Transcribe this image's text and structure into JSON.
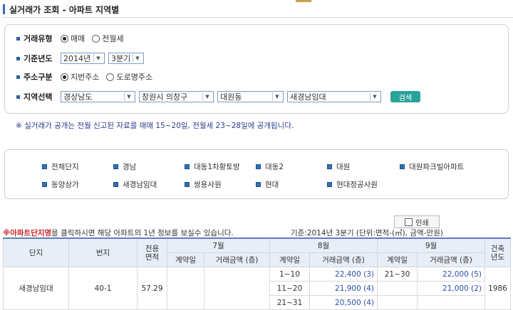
{
  "page_title": "실거래가 조회 - 아파트 지역별",
  "search": {
    "deal_type": {
      "label": "거래유형",
      "options": [
        {
          "text": "매매",
          "checked": true
        },
        {
          "text": "전월세",
          "checked": false
        }
      ]
    },
    "period": {
      "label": "기준년도",
      "year": "2014년",
      "quarter": "3분기"
    },
    "address": {
      "label": "주소구분",
      "options": [
        {
          "text": "지번주소",
          "checked": true
        },
        {
          "text": "도로명주소",
          "checked": false
        }
      ]
    },
    "region": {
      "label": "지역선택",
      "province": "경상남도",
      "city": "창원시 의창구",
      "dong": "대원동",
      "complex": "새경남임대"
    },
    "search_button": "검색"
  },
  "notice": "※ 실거래가 공개는 전월 신고된 자료를 매매 15~20일, 전월세 23~28일에 공개됩니다.",
  "complexes": [
    "전체단지",
    "경남",
    "대동1차황토방",
    "대동2",
    "대원",
    "대원파크빌아파트",
    "동양상가",
    "새경남임대",
    "쌍용사원",
    "현대",
    "현대정공사원"
  ],
  "hint": {
    "bold": "※아파트단지명",
    "rest": "을 클릭하시면 해당 아파트의 1년 정보를 보실수 있습니다."
  },
  "basis": "기준:2014년 3분기   (단위:면적-(㎡), 금액-만원)",
  "print_label": "인쇄",
  "table": {
    "headers": {
      "complex": "단지",
      "lot": "번지",
      "area": "전용\n면적",
      "build_year": "건축\n년도"
    },
    "months": [
      "7월",
      "8월",
      "9월"
    ],
    "sub": {
      "contract_day": "계약일",
      "amount": "거래금액 (층)"
    },
    "row": {
      "complex": "새경남임대",
      "lot": "40-1",
      "area": "57.29",
      "build_year": "1986",
      "aug": [
        {
          "day": "1~10",
          "amount": "22,400 (3)"
        },
        {
          "day": "11~20",
          "amount": "21,900 (4)"
        },
        {
          "day": "21~31",
          "amount": "20,500 (4)"
        }
      ],
      "sep": [
        {
          "day": "21~30",
          "amount": "22,000 (5)"
        },
        {
          "day": "",
          "amount": "21,000 (2)"
        }
      ]
    }
  },
  "colors": {
    "accent": "#2f5fa0",
    "search_button": "#2aa39a",
    "notice_text": "#2a3f8f",
    "table_header": "#e8eef8"
  }
}
